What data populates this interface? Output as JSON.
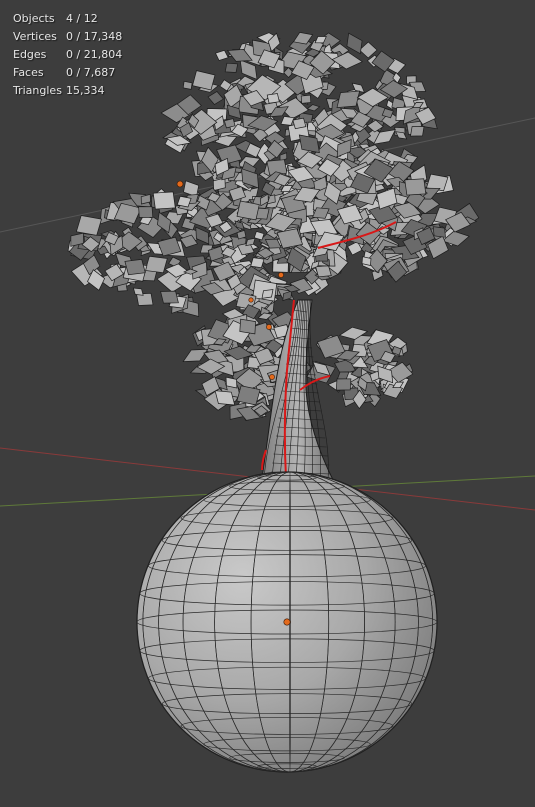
{
  "stats": {
    "objects": {
      "label": "Objects",
      "value": "4 / 12"
    },
    "vertices": {
      "label": "Vertices",
      "value": "0 / 17,348"
    },
    "edges": {
      "label": "Edges",
      "value": "0 / 21,804"
    },
    "faces": {
      "label": "Faces",
      "value": "0 / 7,687"
    },
    "triangles": {
      "label": "Triangles",
      "value": "15,334"
    }
  },
  "colors": {
    "background": "#3d3d3d",
    "x_axis": "#8a3a3a",
    "y_axis": "#5f7a3a",
    "mesh_face": "#a8a8a8",
    "wire": "#1c1c1c",
    "seam": "#d81818",
    "origin": "#e36a1c"
  },
  "icons": [
    "tree-mesh-icon",
    "sphere-mesh-icon",
    "object-origin-icon"
  ]
}
